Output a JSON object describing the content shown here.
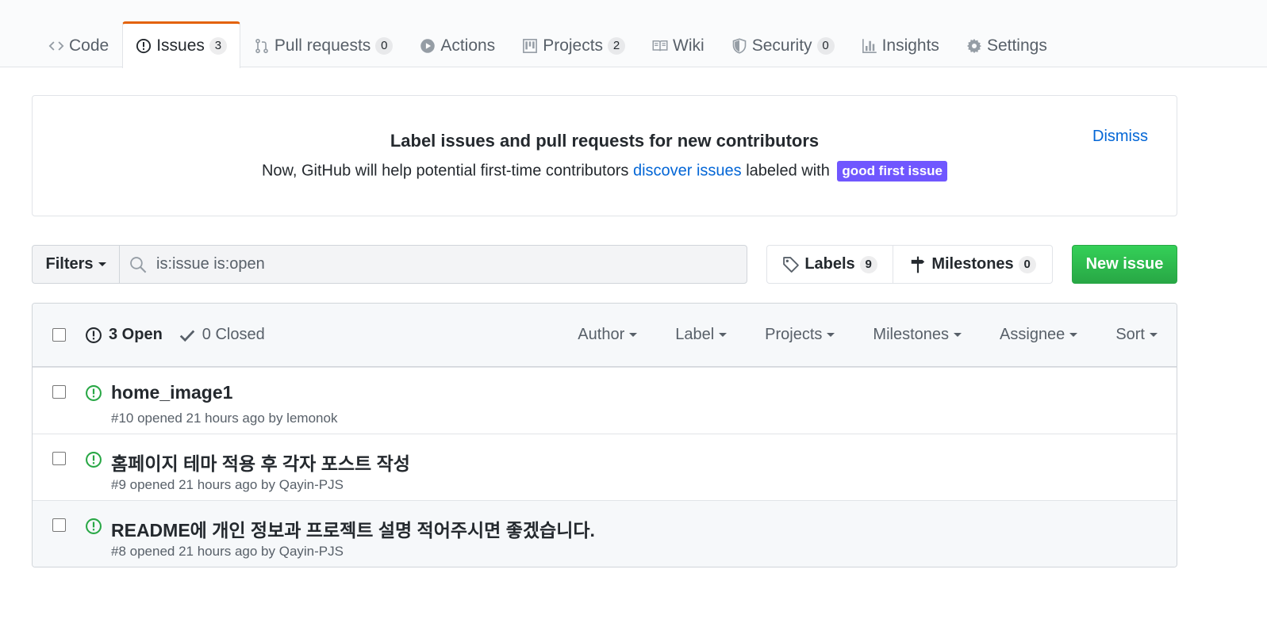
{
  "tabs": [
    {
      "label": "Code",
      "icon": "code-icon",
      "counter": null,
      "selected": false
    },
    {
      "label": "Issues",
      "icon": "issue-opened-icon",
      "counter": "3",
      "selected": true
    },
    {
      "label": "Pull requests",
      "icon": "git-pull-request-icon",
      "counter": "0",
      "selected": false
    },
    {
      "label": "Actions",
      "icon": "play-icon",
      "counter": null,
      "selected": false
    },
    {
      "label": "Projects",
      "icon": "project-icon",
      "counter": "2",
      "selected": false
    },
    {
      "label": "Wiki",
      "icon": "book-icon",
      "counter": null,
      "selected": false
    },
    {
      "label": "Security",
      "icon": "shield-icon",
      "counter": "0",
      "selected": false
    },
    {
      "label": "Insights",
      "icon": "graph-icon",
      "counter": null,
      "selected": false
    },
    {
      "label": "Settings",
      "icon": "gear-icon",
      "counter": null,
      "selected": false
    }
  ],
  "banner": {
    "title": "Label issues and pull requests for new contributors",
    "text_before": "Now, GitHub will help potential first-time contributors",
    "link": "discover issues",
    "text_after": "labeled with",
    "label": "good first issue",
    "label_color": "#7057ff",
    "dismiss": "Dismiss"
  },
  "filters": {
    "label": "Filters",
    "search_value": "is:issue is:open"
  },
  "labels_button": {
    "label": "Labels",
    "count": "9"
  },
  "milestones_button": {
    "label": "Milestones",
    "count": "0"
  },
  "new_issue": {
    "label": "New issue",
    "color": "#28a745"
  },
  "issues_header": {
    "open_label": "3 Open",
    "closed_label": "0 Closed",
    "menus": [
      "Author",
      "Label",
      "Projects",
      "Milestones",
      "Assignee",
      "Sort"
    ]
  },
  "issues": [
    {
      "title": "home_image1",
      "meta": "#10 opened 21 hours ago by lemonok"
    },
    {
      "title": "홈페이지 테마 적용 후 각자 포스트 작성",
      "meta": "#9 opened 21 hours ago by Qayin-PJS"
    },
    {
      "title": "README에 개인 정보과 프로젝트 설명 적어주시면 좋겠습니다.",
      "meta": "#8 opened 21 hours ago by Qayin-PJS"
    }
  ]
}
